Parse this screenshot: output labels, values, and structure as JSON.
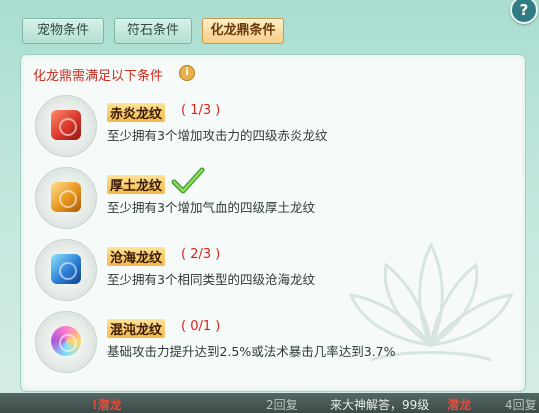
{
  "tabs": [
    {
      "label": "宠物条件",
      "active": false
    },
    {
      "label": "符石条件",
      "active": false
    },
    {
      "label": "化龙鼎条件",
      "active": true
    }
  ],
  "help_icon": "question-icon",
  "header": {
    "title": "化龙鼎需满足以下条件",
    "info_icon": "info-icon"
  },
  "conditions": [
    {
      "name": "赤炎龙纹",
      "progress": "( 1/3 )",
      "desc": "至少拥有3个增加攻击力的四级赤炎龙纹",
      "gem": "red-dragon-gem-icon",
      "color": "#d9382b",
      "done": false
    },
    {
      "name": "厚土龙纹",
      "progress": "",
      "desc": "至少拥有3个增加气血的四级厚土龙纹",
      "gem": "yellow-dragon-gem-icon",
      "color": "#e8951f",
      "done": true
    },
    {
      "name": "沧海龙纹",
      "progress": "( 2/3 )",
      "desc": "至少拥有3个相同类型的四级沧海龙纹",
      "gem": "blue-dragon-gem-icon",
      "color": "#2c7fd6",
      "done": false
    },
    {
      "name": "混沌龙纹",
      "progress": "( 0/1 )",
      "desc": "基础攻击力提升达到2.5%或法术暴击几率达到3.7%",
      "gem": "chaos-dragon-gem-icon",
      "color": "#b25ad6",
      "done": false
    }
  ],
  "footer": {
    "left": "!潜龙",
    "mid1": "2回复",
    "mid2": "来大神解答，99级",
    "mid3": "潜龙",
    "right": "4回复"
  },
  "colors": {
    "accent_red": "#cc2a1e",
    "active_tab": "#f4cf8a",
    "panel": "#bfe6dc"
  }
}
